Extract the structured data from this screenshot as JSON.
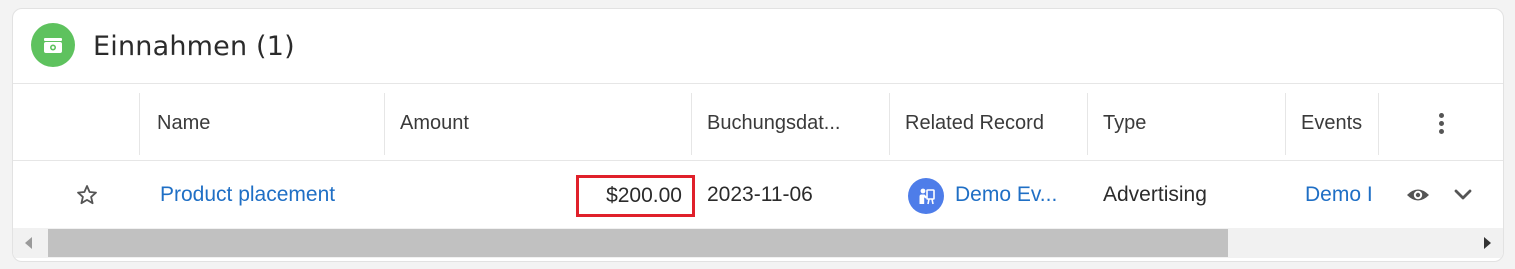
{
  "panel": {
    "title": "Einnahmen (1)",
    "icon": "cash-icon",
    "accent_color": "#5ec25e"
  },
  "table": {
    "columns": [
      "Name",
      "Amount",
      "Buchungsdat...",
      "Related Record",
      "Type",
      "Events"
    ],
    "rows": [
      {
        "name": "Product placement",
        "amount": "$200.00",
        "date": "2023-11-06",
        "related_record": "Demo Ev...",
        "type": "Advertising",
        "events": "Demo I"
      }
    ]
  },
  "colors": {
    "link": "#1f6fc5",
    "highlight": "#e0202a",
    "related_record_icon": "#4e7de9"
  }
}
